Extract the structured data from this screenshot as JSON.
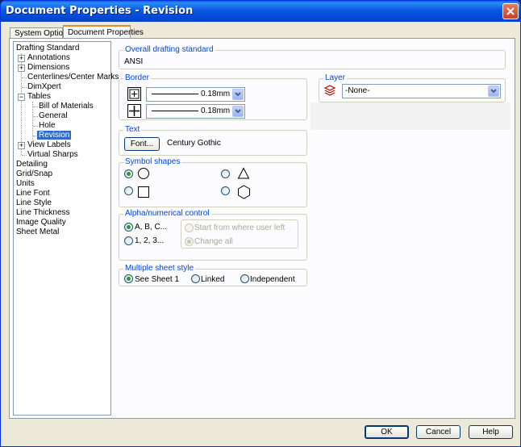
{
  "window": {
    "title": "Document Properties - Revision"
  },
  "tabs": [
    {
      "label": "System Options",
      "active": false
    },
    {
      "label": "Document Properties",
      "active": true
    }
  ],
  "tree": {
    "items": [
      {
        "label": "Drafting Standard"
      },
      {
        "label": "Annotations"
      },
      {
        "label": "Dimensions"
      },
      {
        "label": "Centerlines/Center Marks"
      },
      {
        "label": "DimXpert"
      },
      {
        "label": "Tables"
      },
      {
        "label": "Bill of Materials"
      },
      {
        "label": "General"
      },
      {
        "label": "Hole"
      },
      {
        "label": "Revision",
        "selected": true
      },
      {
        "label": "View Labels"
      },
      {
        "label": "Virtual Sharps"
      },
      {
        "label": "Detailing"
      },
      {
        "label": "Grid/Snap"
      },
      {
        "label": "Units"
      },
      {
        "label": "Line Font"
      },
      {
        "label": "Line Style"
      },
      {
        "label": "Line Thickness"
      },
      {
        "label": "Image Quality"
      },
      {
        "label": "Sheet Metal"
      }
    ]
  },
  "overall": {
    "label": "Overall drafting standard",
    "value": "ANSI"
  },
  "border": {
    "label": "Border",
    "rows": [
      {
        "value": "0.18mm",
        "icon": "border-box-icon"
      },
      {
        "value": "0.18mm",
        "icon": "border-grid-icon"
      }
    ]
  },
  "layer": {
    "label": "Layer",
    "value": "-None-",
    "icon": "layers-icon"
  },
  "text": {
    "label": "Text",
    "font_button": "Font...",
    "font_name": "Century Gothic"
  },
  "symbol_shapes": {
    "label": "Symbol shapes",
    "options": [
      {
        "shape": "circle",
        "checked": true
      },
      {
        "shape": "triangle",
        "checked": false
      },
      {
        "shape": "square",
        "checked": false
      },
      {
        "shape": "hexagon",
        "checked": false
      }
    ]
  },
  "alpha": {
    "label": "Alpha/numerical control",
    "options": [
      {
        "label": "A, B, C...",
        "checked": true
      },
      {
        "label": "1, 2, 3...",
        "checked": false
      }
    ],
    "sub_options": [
      {
        "label": "Start from where user left",
        "checked": false,
        "disabled": true
      },
      {
        "label": "Change all",
        "checked": true,
        "disabled": true
      }
    ]
  },
  "sheet_style": {
    "label": "Multiple sheet style",
    "options": [
      {
        "label": "See Sheet 1",
        "checked": true
      },
      {
        "label": "Linked",
        "checked": false
      },
      {
        "label": "Independent",
        "checked": false
      }
    ]
  },
  "buttons": {
    "ok": "OK",
    "cancel": "Cancel",
    "help": "Help"
  },
  "colors": {
    "titlebar": "#0a5fe6",
    "group_label": "#0046d5",
    "selection": "#316ac5",
    "window_bg": "#ece9d8"
  }
}
